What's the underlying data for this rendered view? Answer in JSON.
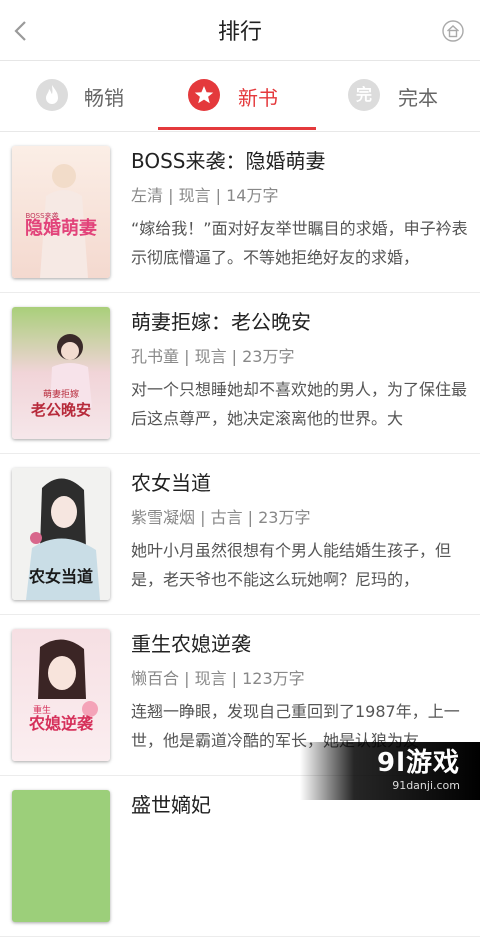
{
  "header": {
    "title": "排行"
  },
  "tabs": [
    {
      "label": "畅销",
      "icon": "flame-icon",
      "active": false
    },
    {
      "label": "新书",
      "icon": "star-icon",
      "active": true
    },
    {
      "label": "完本",
      "icon": "completed-icon",
      "icon_text": "完",
      "active": false
    }
  ],
  "books": [
    {
      "title": "BOSS来袭：隐婚萌妻",
      "meta": "左清 | 现言 | 14万字",
      "desc": "“嫁给我！”面对好友举世瞩目的求婚，申子衿表示彻底懵逼了。不等她拒绝好友的求婚，",
      "cover_text": "隐婚萌妻",
      "cover_sub": "BOSS来袭"
    },
    {
      "title": "萌妻拒嫁：老公晚安",
      "meta": "孔书童 | 现言 | 23万字",
      "desc": "对一个只想睡她却不喜欢她的男人，为了保住最后这点尊严，她决定滚离他的世界。大",
      "cover_text": "老公晚安",
      "cover_sub": "萌妻拒嫁"
    },
    {
      "title": "农女当道",
      "meta": "紫雪凝烟 | 古言 | 23万字",
      "desc": "她叶小月虽然很想有个男人能结婚生孩子，但是，老天爷也不能这么玩她啊？尼玛的，",
      "cover_text": "农女当道",
      "cover_sub": ""
    },
    {
      "title": "重生农媳逆袭",
      "meta": "懒百合 | 现言 | 123万字",
      "desc": "连翘一睁眼，发现自己重回到了1987年，上一世，他是霸道冷酷的军长，她是认狼为友",
      "cover_text": "农媳逆袭",
      "cover_sub": "重生"
    },
    {
      "title": "盛世嫡妃",
      "meta": "",
      "desc": "",
      "cover_text": "",
      "cover_sub": ""
    }
  ],
  "watermark": {
    "text": "9l游戏",
    "url": "91danji.com"
  },
  "colors": {
    "accent": "#e4393c",
    "inactive_icon": "#dcdcdc"
  }
}
